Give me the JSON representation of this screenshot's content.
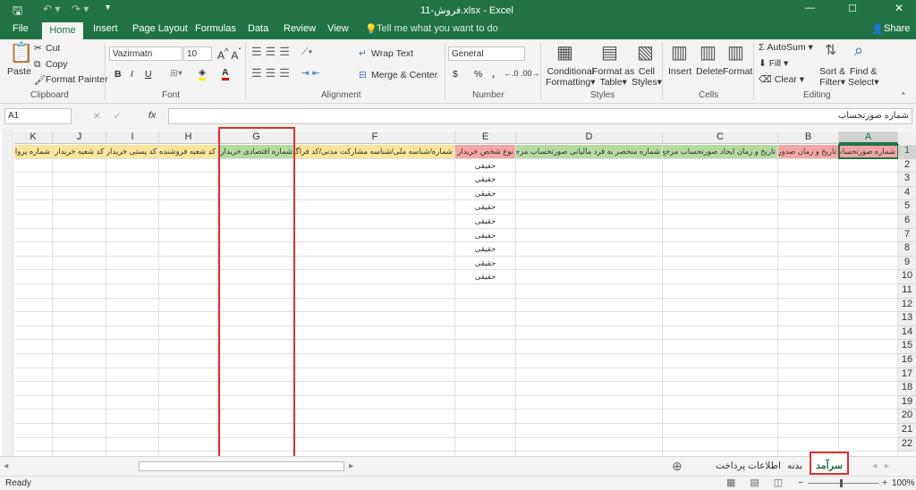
{
  "title": "فروش-11.xlsx - Excel",
  "share_label": "Share",
  "menu_tabs": [
    "File",
    "Home",
    "Insert",
    "Page Layout",
    "Formulas",
    "Data",
    "Review",
    "View"
  ],
  "tell_me": "Tell me what you want to do",
  "ribbon": {
    "clipboard": {
      "paste": "Paste",
      "cut": "Cut",
      "copy": "Copy",
      "format_painter": "Format Painter",
      "label": "Clipboard"
    },
    "font": {
      "name": "Vazirmatn",
      "size": "10",
      "bold": "B",
      "italic": "I",
      "underline": "U",
      "label": "Font"
    },
    "alignment": {
      "wrap": "Wrap Text",
      "merge": "Merge & Center",
      "label": "Alignment"
    },
    "number": {
      "format": "General",
      "currency": "$",
      "percent": "%",
      "comma": ",",
      "label": "Number"
    },
    "styles": {
      "conditional": "Conditional",
      "formatting": "Formatting",
      "format_as": "Format as",
      "table": "Table",
      "cell": "Cell",
      "cell_styles": "Styles",
      "label": "Styles"
    },
    "cells": {
      "insert": "Insert",
      "delete": "Delete",
      "format": "Format",
      "label": "Cells"
    },
    "editing": {
      "autosum": "AutoSum",
      "fill": "Fill",
      "clear": "Clear",
      "sort": "Sort &",
      "filter": "Filter",
      "find": "Find &",
      "select": "Select",
      "label": "Editing"
    }
  },
  "name_box": "A1",
  "formula": "شماره صورتحساب",
  "fx": "fx",
  "columns": [
    "A",
    "B",
    "C",
    "D",
    "E",
    "F",
    "G",
    "H",
    "I",
    "J",
    "K"
  ],
  "headers": [
    "شماره صورتحساب",
    "تاریخ و زمان صدور",
    "تاریخ و زمان ایجاد صورتحساب مرجع",
    "شماره منحصر به فرد مالیاتی صورتحساب مرجع",
    "نوع شخص خریدار",
    "شماره/شناسه ملی/شناسه مشارکت مدنی/کد فراگیر",
    "شماره اقتصادی خریدار",
    "کد شعبه فروشنده",
    "کد پستی خریدار",
    "کد شعبه خریدار",
    "شماره پروانه"
  ],
  "header_colors": [
    "#f4a6a6",
    "#f4a6a6",
    "#b5dba0",
    "#b5dba0",
    "#f4a6a6",
    "#fde59a",
    "#b5dba0",
    "#fde59a",
    "#fde59a",
    "#fde59a",
    "#fde59a"
  ],
  "column_e_values": [
    "حقیقی",
    "حقیقی",
    "حقیقی",
    "حقیقی",
    "حقیقی",
    "حقیقی",
    "حقیقی",
    "حقیقی",
    "حقیقی"
  ],
  "row_numbers": [
    "1",
    "2",
    "3",
    "4",
    "5",
    "6",
    "7",
    "8",
    "9",
    "10",
    "11",
    "12",
    "13",
    "14",
    "15",
    "16",
    "17",
    "18",
    "19",
    "20",
    "21",
    "22"
  ],
  "sheets": [
    "سرآمد",
    "بدنه",
    "اطلاعات پرداخت"
  ],
  "active_sheet": "سرآمد",
  "status": "Ready",
  "zoom": "100%"
}
